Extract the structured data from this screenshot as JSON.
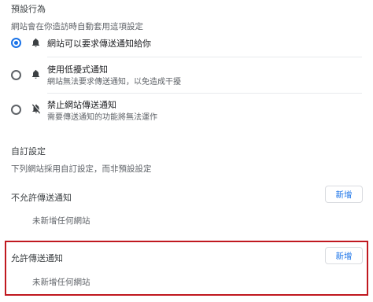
{
  "default_behavior": {
    "title": "預設行為",
    "description": "網站會在你造訪時自動套用這項設定",
    "options": [
      {
        "label": "網站可以要求傳送通知給你",
        "sublabel": "",
        "icon": "bell-icon",
        "checked": true
      },
      {
        "label": "使用低擾式通知",
        "sublabel": "網站無法要求傳送通知，以免造成干擾",
        "icon": "bell-icon",
        "checked": false
      },
      {
        "label": "禁止網站傳送通知",
        "sublabel": "需要傳送通知的功能將無法運作",
        "icon": "bell-off-icon",
        "checked": false
      }
    ]
  },
  "custom": {
    "title": "自訂設定",
    "description": "下列網站採用自訂設定，而非預設設定",
    "blocked": {
      "title": "不允許傳送通知",
      "add_label": "新增",
      "empty_text": "未新增任何網站"
    },
    "allowed": {
      "title": "允許傳送通知",
      "add_label": "新增",
      "empty_text": "未新增任何網站"
    }
  },
  "colors": {
    "accent": "#1a73e8",
    "highlight": "#c0181f"
  }
}
